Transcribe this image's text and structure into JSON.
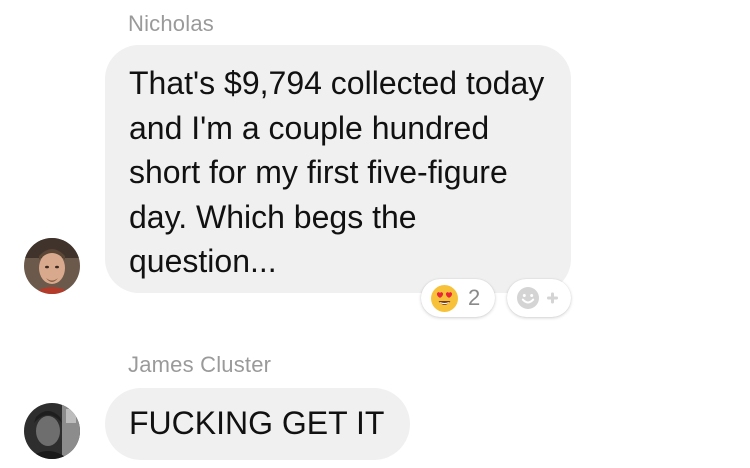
{
  "messages": [
    {
      "sender": "Nicholas",
      "text": "That's $9,794 collected today and I'm a couple hundred short for my first five-figure day. Which begs the question...",
      "reaction": {
        "emoji": "heart-eyes",
        "count": "2"
      }
    },
    {
      "sender": "James Cluster",
      "text": "FUCKING GET IT"
    }
  ],
  "colors": {
    "bubble_bg": "#f0f0f0",
    "sender_name": "#9a9a9a",
    "message_text": "#111111",
    "reaction_count": "#8a8a8a",
    "add_reaction_icon": "#d4d4d4"
  }
}
